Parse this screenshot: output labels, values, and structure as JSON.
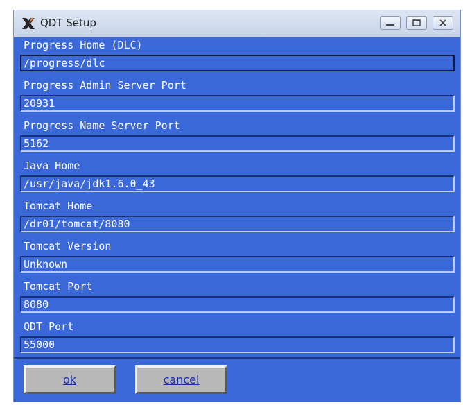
{
  "window": {
    "title": "QDT Setup",
    "icon": "x-logo-icon"
  },
  "titlebar_buttons": [
    "minimize",
    "maximize",
    "close"
  ],
  "fields": [
    {
      "label": "Progress Home (DLC)",
      "value": "/progress/dlc"
    },
    {
      "label": "Progress Admin Server Port",
      "value": "20931"
    },
    {
      "label": "Progress Name Server Port",
      "value": "5162"
    },
    {
      "label": "Java Home",
      "value": "/usr/java/jdk1.6.0_43"
    },
    {
      "label": "Tomcat Home",
      "value": "/dr01/tomcat/8080"
    },
    {
      "label": "Tomcat Version",
      "value": "Unknown"
    },
    {
      "label": "Tomcat Port",
      "value": "8080"
    },
    {
      "label": "QDT Port",
      "value": "55000"
    }
  ],
  "buttons": {
    "ok": "ok",
    "cancel": "cancel"
  },
  "colors": {
    "window_bg": "#3b68d8",
    "label_text": "#ffffff",
    "button_text": "#1a2fb0"
  }
}
